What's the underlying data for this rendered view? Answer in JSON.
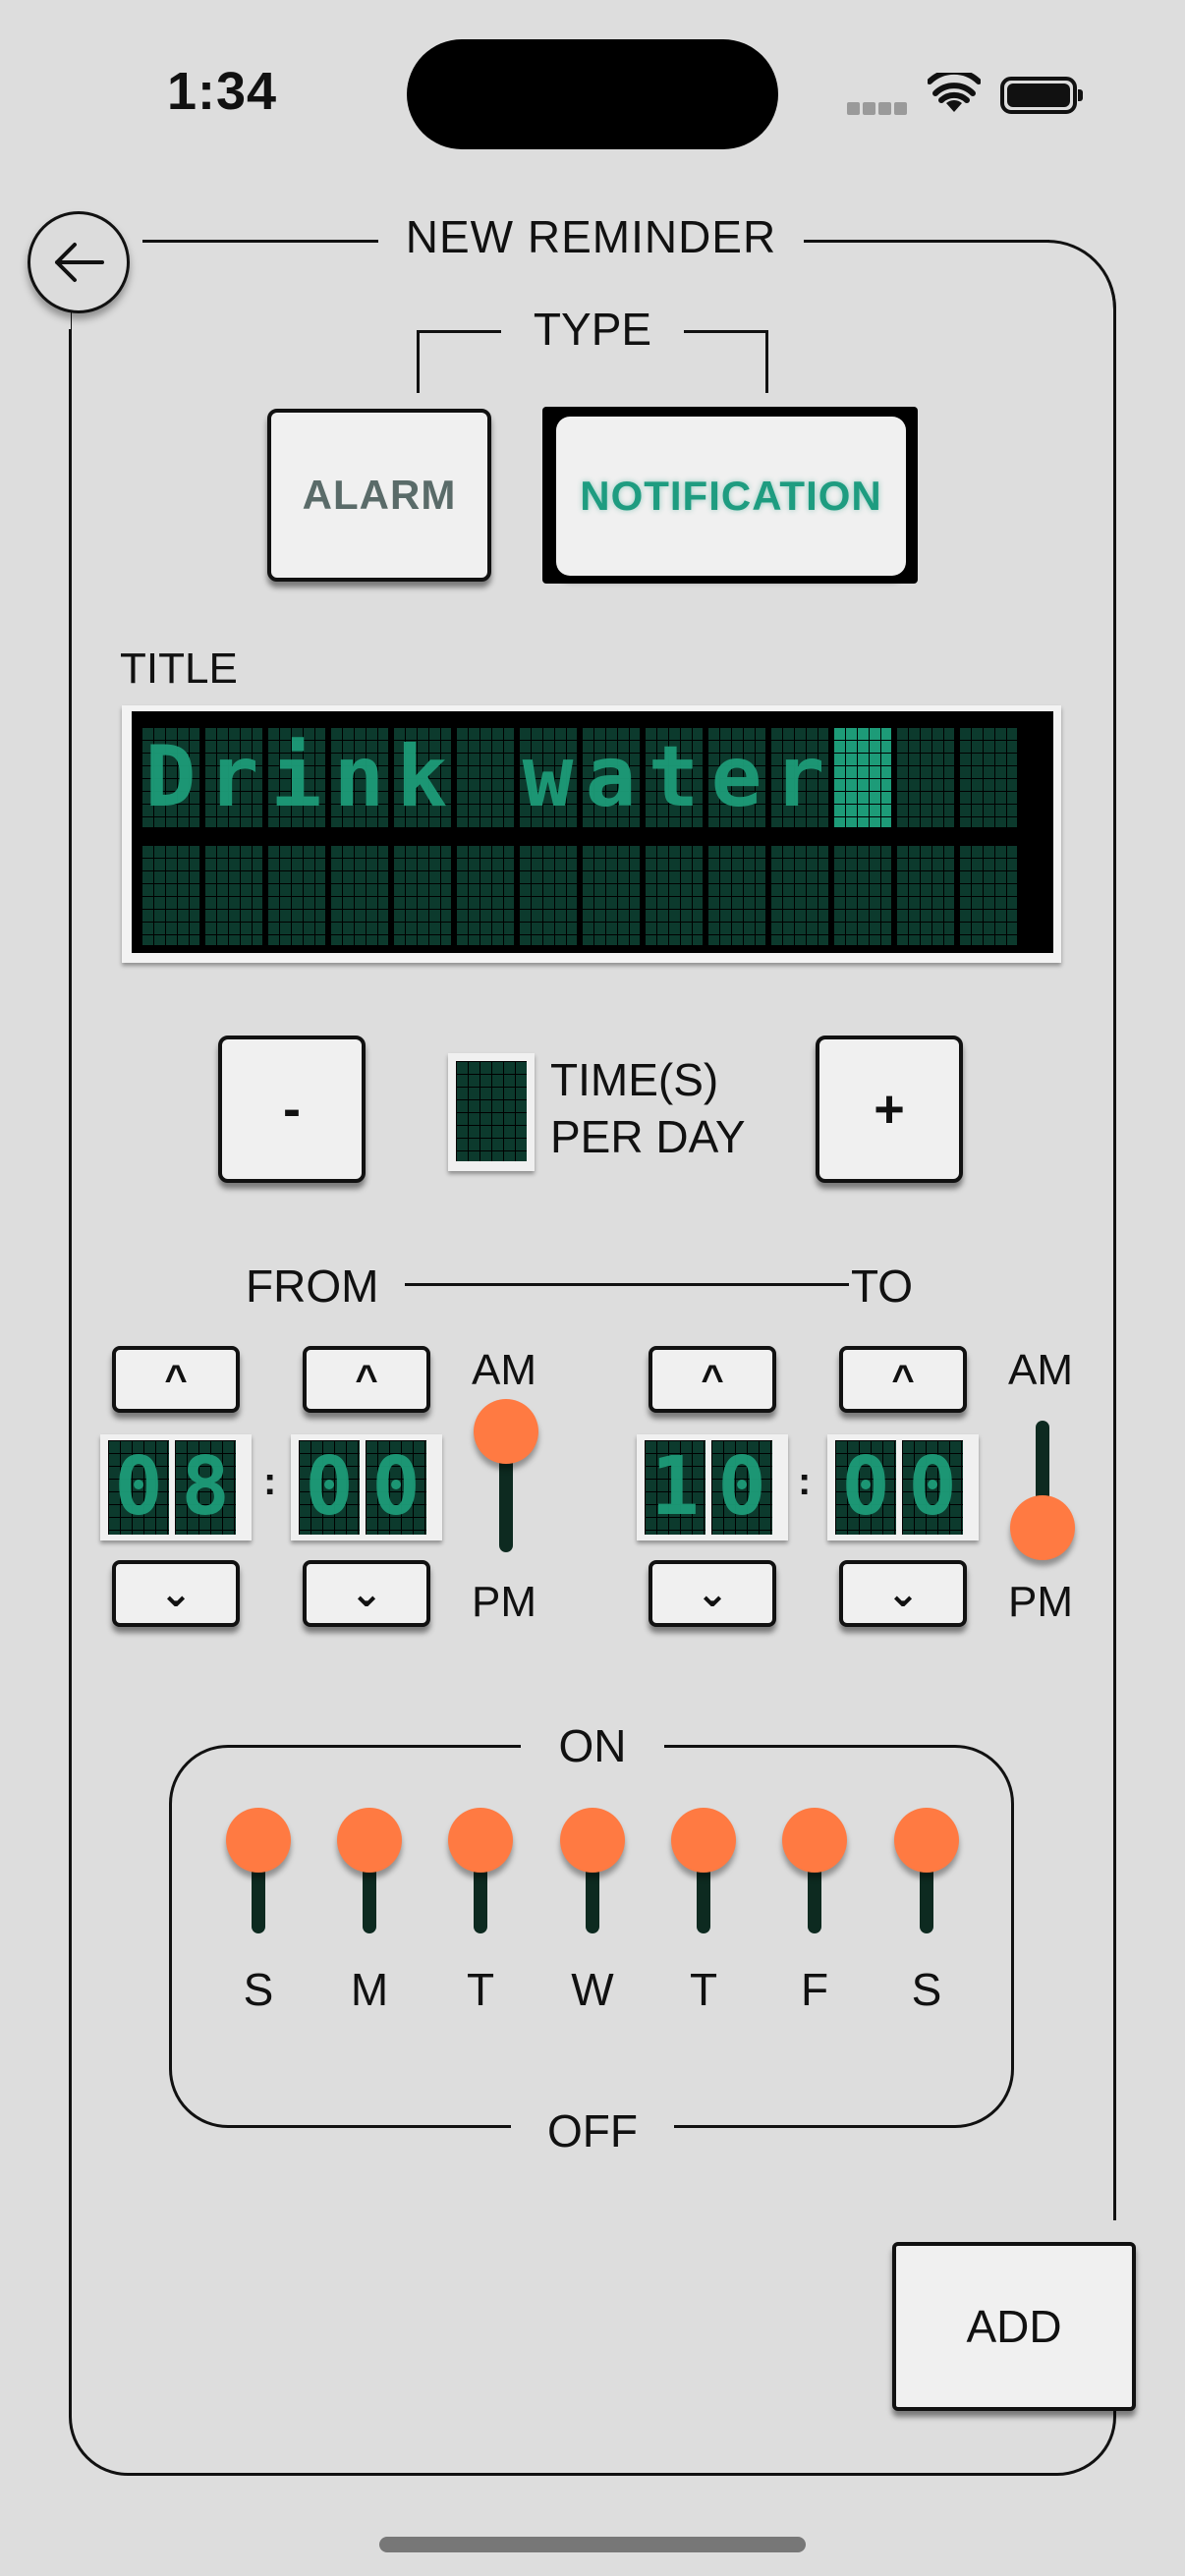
{
  "status_bar": {
    "time": "1:34"
  },
  "header": {
    "title": "NEW REMINDER"
  },
  "type": {
    "label": "TYPE",
    "options": [
      "ALARM",
      "NOTIFICATION"
    ],
    "selected": "NOTIFICATION"
  },
  "title_field": {
    "label": "TITLE",
    "value": "Drink water",
    "row1": [
      "D",
      "r",
      "i",
      "n",
      "k",
      " ",
      "w",
      "a",
      "t",
      "e",
      "r"
    ]
  },
  "frequency": {
    "minus": "-",
    "plus": "+",
    "count": "",
    "label_line1": "TIME(S)",
    "label_line2": "PER DAY"
  },
  "from": {
    "label": "FROM",
    "hour": [
      "0",
      "8"
    ],
    "minute": [
      "0",
      "0"
    ],
    "period": "AM",
    "am": "AM",
    "pm": "PM"
  },
  "to": {
    "label": "TO",
    "hour": [
      "1",
      "0"
    ],
    "minute": [
      "0",
      "0"
    ],
    "period": "PM",
    "am": "AM",
    "pm": "PM"
  },
  "arrows": {
    "up": "^",
    "down": "⌄",
    "colon": ":"
  },
  "days": {
    "on_label": "ON",
    "off_label": "OFF",
    "items": [
      {
        "label": "S",
        "on": true
      },
      {
        "label": "M",
        "on": true
      },
      {
        "label": "T",
        "on": true
      },
      {
        "label": "W",
        "on": true
      },
      {
        "label": "T",
        "on": true
      },
      {
        "label": "F",
        "on": true
      },
      {
        "label": "S",
        "on": true
      }
    ]
  },
  "add_button": "ADD",
  "colors": {
    "accent": "#ff7a42",
    "lcd_green": "#1d9b78",
    "background": "#dddddd"
  }
}
